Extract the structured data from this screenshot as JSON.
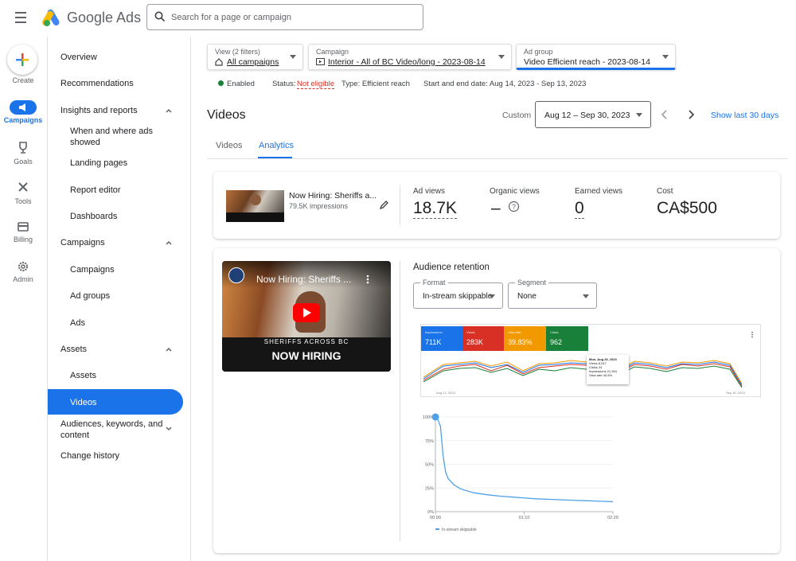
{
  "header": {
    "brand": "Google Ads",
    "search_placeholder": "Search for a page or campaign"
  },
  "rail": {
    "create": "Create",
    "campaigns": "Campaigns",
    "goals": "Goals",
    "tools": "Tools",
    "billing": "Billing",
    "admin": "Admin"
  },
  "nav": {
    "overview": "Overview",
    "recommendations": "Recommendations",
    "insights": "Insights and reports",
    "when_where": "When and where ads showed",
    "landing": "Landing pages",
    "report_editor": "Report editor",
    "dashboards": "Dashboards",
    "campaigns_group": "Campaigns",
    "campaigns": "Campaigns",
    "ad_groups": "Ad groups",
    "ads": "Ads",
    "assets_group": "Assets",
    "assets": "Assets",
    "videos": "Videos",
    "audiences": "Audiences, keywords, and content",
    "change_history": "Change history"
  },
  "filters": {
    "view_caption": "View (2 filters)",
    "view_value": "All campaigns",
    "campaign_caption": "Campaign",
    "campaign_value": "Interior - All of BC Video/long - 2023-08-14",
    "adgroup_caption": "Ad group",
    "adgroup_value": "Video Efficient reach - 2023-08-14"
  },
  "status": {
    "enabled": "Enabled",
    "status_label": "Status:",
    "status_value": "Not eligible",
    "type": "Type: Efficient reach",
    "dates": "Start and end date: Aug 14, 2023 - Sep 13, 2023"
  },
  "page": {
    "title": "Videos",
    "range_label": "Custom",
    "date_range": "Aug 12 – Sep 30, 2023",
    "show_last": "Show last 30 days",
    "tab_videos": "Videos",
    "tab_analytics": "Analytics"
  },
  "video_card": {
    "name": "Now Hiring: Sheriffs a...",
    "impressions": "79.5K impressions",
    "ad_views_label": "Ad views",
    "ad_views": "18.7K",
    "organic_label": "Organic views",
    "organic": "–",
    "earned_label": "Earned views",
    "earned": "0",
    "cost_label": "Cost",
    "cost": "CA$500"
  },
  "player": {
    "title": "Now Hiring: Sheriffs ...",
    "banner1": "SHERIFFS ACROSS BC",
    "banner2": "NOW HIRING"
  },
  "retention": {
    "title": "Audience retention",
    "format_caption": "Format",
    "format_value": "In-stream skippable",
    "segment_caption": "Segment",
    "segment_value": "None",
    "legend": "In-stream skippable",
    "y_ticks": [
      "100%",
      "75%",
      "50%",
      "25%",
      "0%"
    ],
    "x_ticks": [
      "00:00",
      "01:10",
      "02:20"
    ]
  },
  "tiles": [
    {
      "label": "Impressions",
      "value": "711K",
      "color": "#1a73e8"
    },
    {
      "label": "Views",
      "value": "283K",
      "color": "#d93025"
    },
    {
      "label": "View rate",
      "value": "39.83%",
      "color": "#f29900"
    },
    {
      "label": "Clicks",
      "value": "962",
      "color": "#188038"
    }
  ],
  "mini_chart": {
    "start": "Aug 12, 2023",
    "end": "Sep 30, 2023",
    "tooltip_date": "Mon, Aug 28, 2023",
    "tooltip_rows": [
      "Views 8,247",
      "Clicks 24",
      "Impressions 21,304",
      "View rate 40.5%"
    ]
  },
  "chart_data": {
    "type": "line",
    "x": [
      0,
      2,
      4,
      6,
      8,
      10,
      15,
      20,
      30,
      40,
      50,
      60,
      70,
      80,
      90,
      100,
      110,
      120,
      130,
      140
    ],
    "series": [
      {
        "name": "In-stream skippable",
        "values": [
          100,
          97,
          90,
          60,
          42,
          35,
          28,
          24,
          20,
          18,
          16.5,
          15.5,
          14.5,
          13.5,
          13,
          12.5,
          12,
          11.5,
          11,
          10.5
        ]
      }
    ],
    "xlabel": "",
    "ylabel": "",
    "ylim": [
      0,
      100
    ],
    "colors": {
      "line": "#4ea1e8"
    }
  }
}
